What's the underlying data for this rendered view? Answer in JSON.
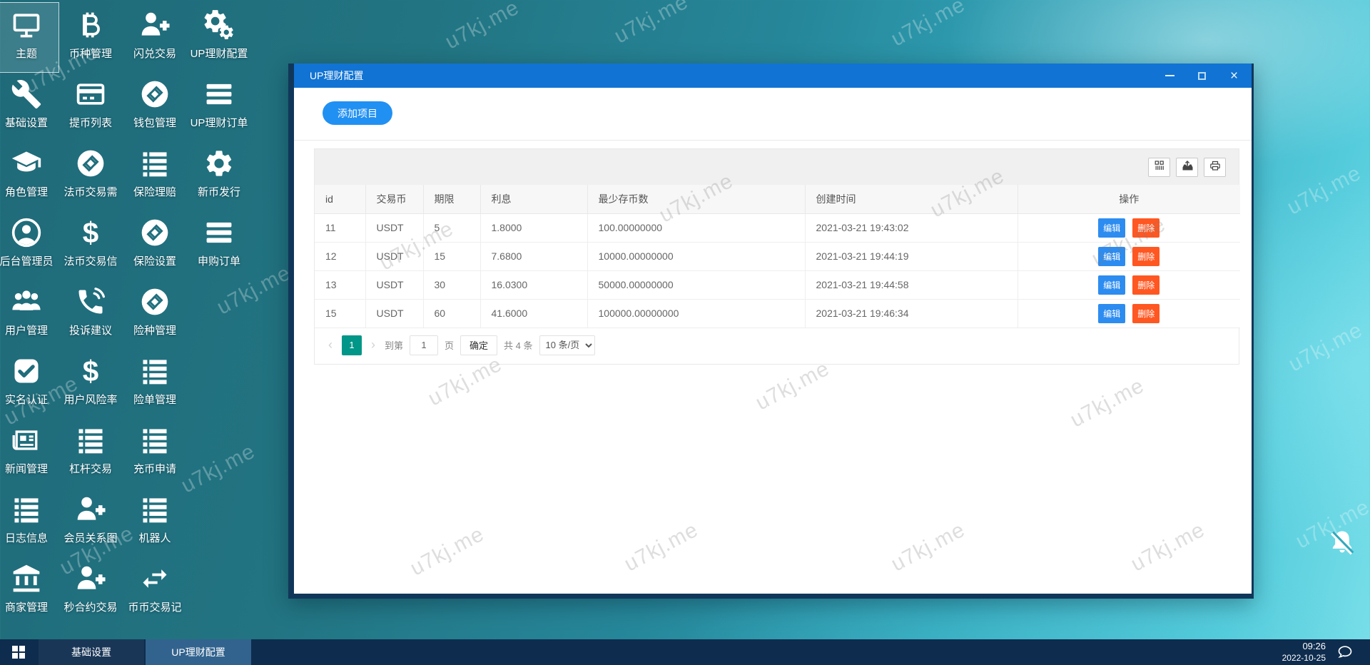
{
  "watermark_text": "u7kj.me",
  "colors": {
    "accent": "#2190f3",
    "titlebar": "#1173d3",
    "page_active": "#009688",
    "edit": "#2d8cf0",
    "delete": "#ff5722",
    "taskbar": "#0e2c4e",
    "taskbar_active": "#32638e"
  },
  "desktop": {
    "icons": [
      {
        "label": "主题",
        "icon": "monitor-icon",
        "selected": true
      },
      {
        "label": "基础设置",
        "icon": "wrench-icon",
        "selected": false
      },
      {
        "label": "角色管理",
        "icon": "graduation-cap-icon",
        "selected": false
      },
      {
        "label": "后台管理员",
        "icon": "admin-user-icon",
        "selected": false
      },
      {
        "label": "用户管理",
        "icon": "users-icon",
        "selected": false
      },
      {
        "label": "实名认证",
        "icon": "check-square-icon",
        "selected": false
      },
      {
        "label": "新闻管理",
        "icon": "newspaper-icon",
        "selected": false
      },
      {
        "label": "日志信息",
        "icon": "list-icon",
        "selected": false
      },
      {
        "label": "商家管理",
        "icon": "bank-icon",
        "selected": false
      },
      {
        "label": "币种管理",
        "icon": "bitcoin-icon",
        "selected": false
      },
      {
        "label": "提币列表",
        "icon": "card-icon",
        "selected": false
      },
      {
        "label": "法币交易需",
        "icon": "coin-icon",
        "selected": false
      },
      {
        "label": "法币交易信",
        "icon": "dollar-icon",
        "selected": false
      },
      {
        "label": "投诉建议",
        "icon": "phone-icon",
        "selected": false
      },
      {
        "label": "用户风险率",
        "icon": "dollar-icon",
        "selected": false
      },
      {
        "label": "杠杆交易",
        "icon": "list-icon",
        "selected": false
      },
      {
        "label": "会员关系图",
        "icon": "user-plus-icon",
        "selected": false
      },
      {
        "label": "秒合约交易",
        "icon": "user-plus-icon",
        "selected": false
      },
      {
        "label": "闪兑交易",
        "icon": "user-plus-icon",
        "selected": false
      },
      {
        "label": "钱包管理",
        "icon": "coin-icon",
        "selected": false
      },
      {
        "label": "保险理赔",
        "icon": "list-icon",
        "selected": false
      },
      {
        "label": "保险设置",
        "icon": "coin-icon",
        "selected": false
      },
      {
        "label": "险种管理",
        "icon": "coin-icon",
        "selected": false
      },
      {
        "label": "险单管理",
        "icon": "list-icon",
        "selected": false
      },
      {
        "label": "充币申请",
        "icon": "list-icon",
        "selected": false
      },
      {
        "label": "机器人",
        "icon": "list-icon",
        "selected": false
      },
      {
        "label": "币币交易记",
        "icon": "swap-icon",
        "selected": false
      },
      {
        "label": "UP理财配置",
        "icon": "gears-icon",
        "selected": false
      },
      {
        "label": "UP理财订单",
        "icon": "menu-icon",
        "selected": false
      },
      {
        "label": "新币发行",
        "icon": "gear-icon",
        "selected": false
      },
      {
        "label": "申购订单",
        "icon": "menu-icon",
        "selected": false
      }
    ]
  },
  "window": {
    "title": "UP理财配置",
    "add_button": "添加项目",
    "toolbar_icons": [
      "filter-columns-icon",
      "export-icon",
      "print-icon"
    ],
    "table": {
      "columns": [
        "id",
        "交易币",
        "期限",
        "利息",
        "最少存币数",
        "创建时间",
        "操作"
      ],
      "rows": [
        {
          "id": "11",
          "coin": "USDT",
          "period": "5",
          "interest": "1.8000",
          "min_deposit": "100.00000000",
          "created": "2021-03-21 19:43:02"
        },
        {
          "id": "12",
          "coin": "USDT",
          "period": "15",
          "interest": "7.6800",
          "min_deposit": "10000.00000000",
          "created": "2021-03-21 19:44:19"
        },
        {
          "id": "13",
          "coin": "USDT",
          "period": "30",
          "interest": "16.0300",
          "min_deposit": "50000.00000000",
          "created": "2021-03-21 19:44:58"
        },
        {
          "id": "15",
          "coin": "USDT",
          "period": "60",
          "interest": "41.6000",
          "min_deposit": "100000.00000000",
          "created": "2021-03-21 19:46:34"
        }
      ],
      "edit_label": "编辑",
      "delete_label": "删除"
    },
    "pagination": {
      "prev": "‹",
      "page": "1",
      "next": "›",
      "goto_label": "到第",
      "goto_value": "1",
      "page_unit": "页",
      "confirm": "确定",
      "total": "共 4 条",
      "page_size": "10 条/页"
    }
  },
  "taskbar": {
    "items": [
      {
        "label": "基础设置",
        "active": false
      },
      {
        "label": "UP理财配置",
        "active": true
      }
    ],
    "clock": {
      "time": "09:26",
      "date": "2022-10-25"
    }
  }
}
